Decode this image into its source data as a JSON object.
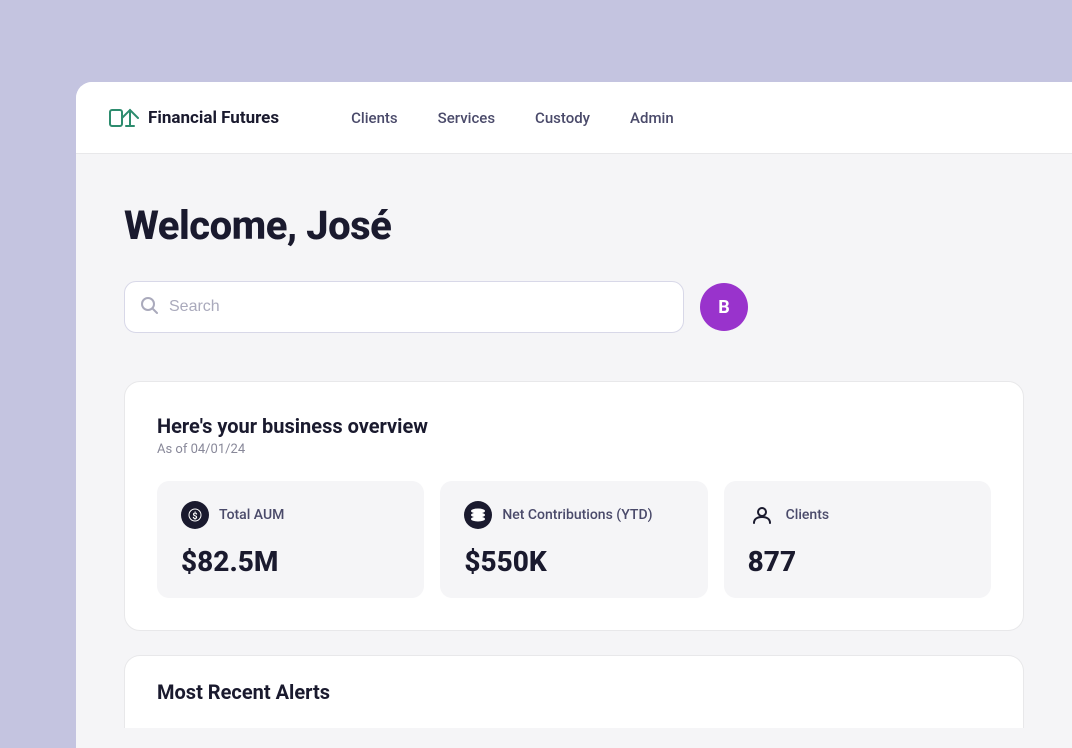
{
  "brand": {
    "name": "Financial Futures"
  },
  "nav": {
    "items": [
      {
        "label": "Clients",
        "id": "clients"
      },
      {
        "label": "Services",
        "id": "services"
      },
      {
        "label": "Custody",
        "id": "custody"
      },
      {
        "label": "Admin",
        "id": "admin"
      }
    ]
  },
  "welcome": {
    "title": "Welcome, José"
  },
  "search": {
    "placeholder": "Search"
  },
  "user_avatar": {
    "initials": "B"
  },
  "overview": {
    "title": "Here's your business overview",
    "date_label": "As of 04/01/24",
    "metrics": [
      {
        "id": "total-aum",
        "label": "Total AUM",
        "value": "$82.5M",
        "icon": "$",
        "icon_style": "dark"
      },
      {
        "id": "net-contributions",
        "label": "Net Contributions (YTD)",
        "value": "$550K",
        "icon": "≡",
        "icon_style": "dark"
      },
      {
        "id": "clients",
        "label": "Clients",
        "value": "877",
        "icon": "👤",
        "icon_style": "light"
      }
    ]
  },
  "alerts": {
    "title": "Most Recent Alerts"
  },
  "colors": {
    "accent_purple": "#9933cc",
    "bg_light_purple": "#c4c4e0",
    "text_dark": "#1a1a2e"
  }
}
